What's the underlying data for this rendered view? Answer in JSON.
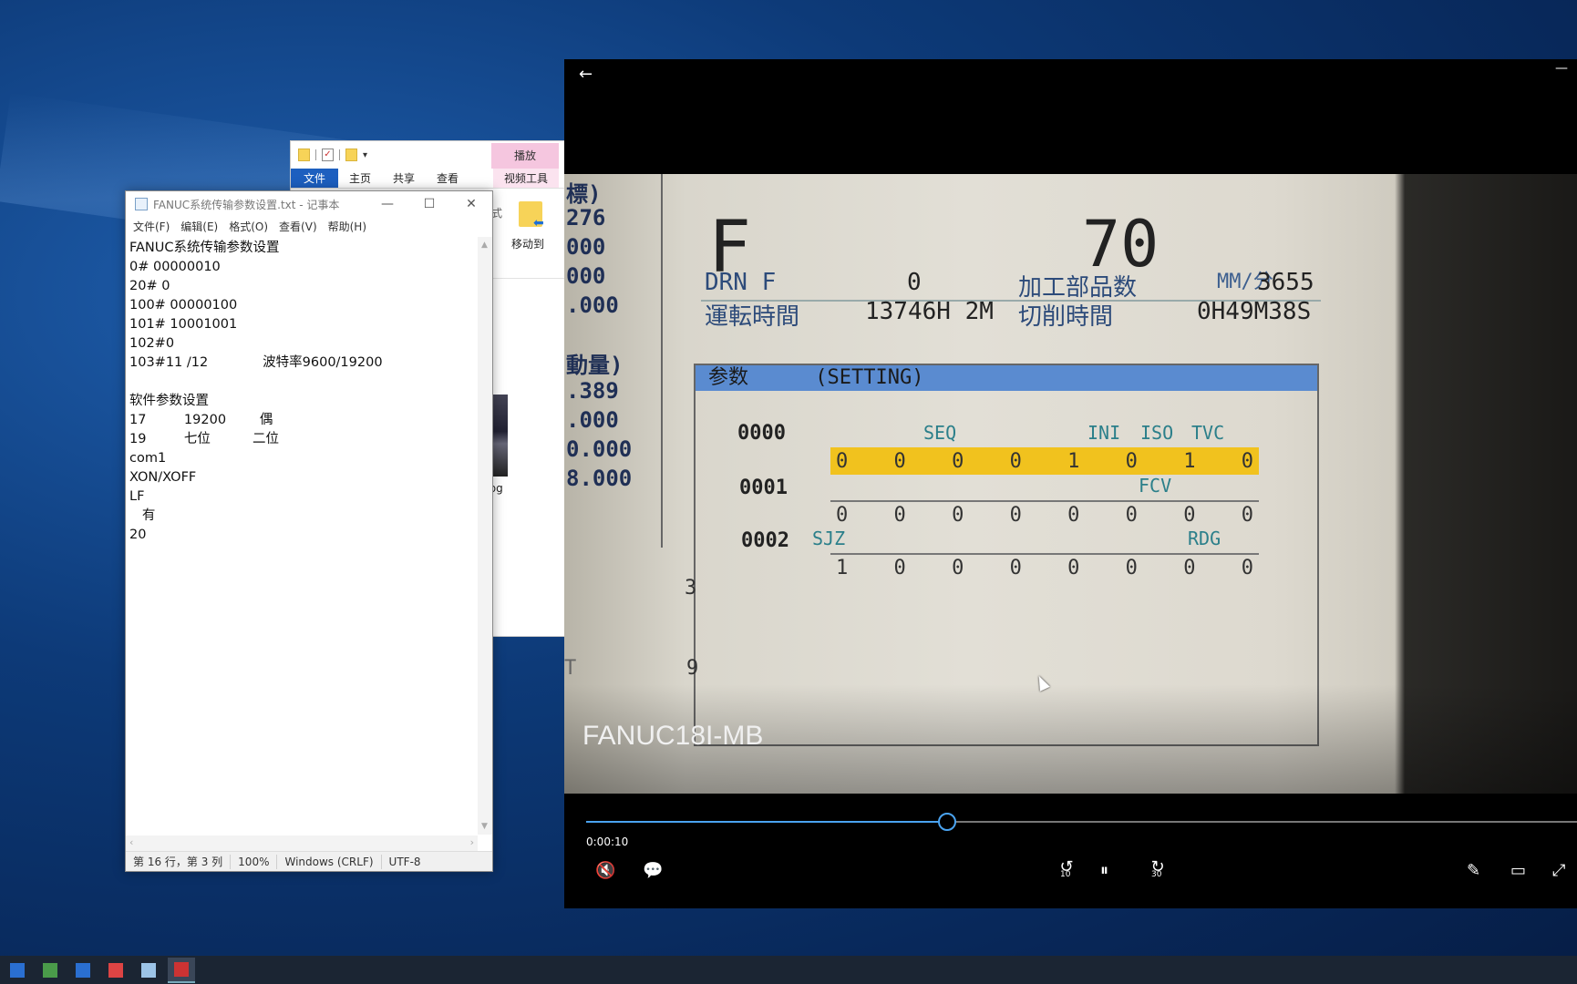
{
  "explorer": {
    "play_tab": "播放",
    "tabs": [
      "文件",
      "主页",
      "共享",
      "查看"
    ],
    "video_tools_tab": "视频工具",
    "fs_label": "方式",
    "move_to": "移动到",
    "file_label": "C.jpg"
  },
  "notepad": {
    "title": "FANUC系统传输参数设置.txt - 记事本",
    "controls": {
      "minimize": "—",
      "maximize": "☐",
      "close": "✕"
    },
    "menu": [
      "文件(F)",
      "编辑(E)",
      "格式(O)",
      "查看(V)",
      "帮助(H)"
    ],
    "lines": [
      "FANUC系统传输参数设置",
      "0# 00000010",
      "20# 0",
      "100# 00000100",
      "101# 10001001",
      "102#0",
      "103#11 /12             波特率9600/19200",
      "",
      "软件参数设置",
      "17         19200        偶",
      "19         七位          二位",
      "com1",
      "XON/XOFF",
      "LF",
      "   有",
      "20"
    ],
    "status": {
      "position": "第 16 行，第 3 列",
      "zoom": "100%",
      "line_ending": "Windows (CRLF)",
      "encoding": "UTF-8"
    }
  },
  "player": {
    "back_icon": "←",
    "minimize_icon": "—",
    "time": "0:00:10",
    "progress": 0.364,
    "caption": "FANUC18I-MB",
    "controls": {
      "mute": "🔇",
      "subtitles": "💬",
      "rewind": "10",
      "pause": "⏸",
      "forward": "30",
      "pen": "✎",
      "miniview": "▭",
      "fullscreen": "⤢"
    }
  },
  "cnc_screen": {
    "left_column": [
      "標)",
      "276",
      "000",
      "000",
      ".000",
      "動量)",
      ".389",
      ".000",
      "0.000",
      "8.000"
    ],
    "feed_letter": "F",
    "feed_value": "70",
    "feed_unit": "MM/分",
    "drn_label": "DRN F",
    "drn_value": "0",
    "parts_label": "加工部品数",
    "parts_value": "3655",
    "run_label": "運転時間",
    "run_value": "13746H 2M",
    "cut_label": "切削時間",
    "cut_value": "0H49M38S",
    "param_title": "参数",
    "param_mode": "(SETTING)",
    "params": [
      {
        "no": "0000",
        "labels": [
          "SEQ",
          "INI",
          "ISO",
          "TVC"
        ],
        "bits": [
          "0",
          "0",
          "0",
          "0",
          "1",
          "0",
          "1",
          "0"
        ]
      },
      {
        "no": "0001",
        "labels": [
          "FCV"
        ],
        "bits": [
          "0",
          "0",
          "0",
          "0",
          "0",
          "0",
          "0",
          "0"
        ]
      },
      {
        "no": "0002",
        "labels": [
          "SJZ",
          "RDG"
        ],
        "bits": [
          "1",
          "0",
          "0",
          "0",
          "0",
          "0",
          "0",
          "0"
        ]
      }
    ],
    "side_numbers": [
      "3",
      "9"
    ],
    "side_letter": "T"
  },
  "taskbar": {
    "apps": [
      "mail-app-icon",
      "image-app-icon",
      "mail-app-2-icon",
      "document-app-icon",
      "notepad-app-icon",
      "video-app-icon"
    ]
  }
}
